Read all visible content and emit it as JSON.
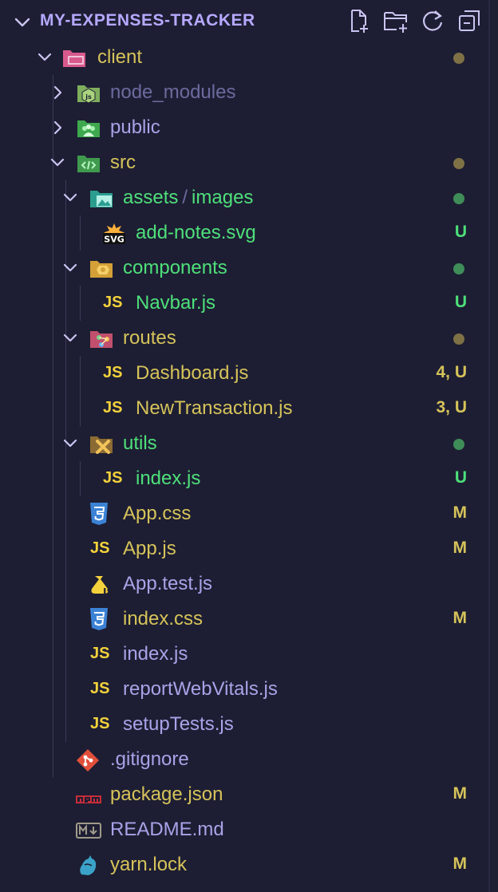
{
  "explorer": {
    "title": "MY-EXPENSES-TRACKER",
    "actions": [
      {
        "name": "new-file-icon"
      },
      {
        "name": "new-folder-icon"
      },
      {
        "name": "refresh-icon"
      },
      {
        "name": "collapse-all-icon"
      }
    ]
  },
  "colors": {
    "modified": "#d6c35a",
    "untracked": "#4ee07a",
    "normal": "#a9a3e8",
    "ignored": "#6c6a9e",
    "dot_modified": "#7e7146",
    "dot_untracked": "#3f8d58"
  },
  "tree": [
    {
      "label": "client",
      "type": "folder",
      "expanded": true,
      "depth": 0,
      "status": "modified-dot",
      "icon": "folder-client-icon"
    },
    {
      "label": "node_modules",
      "type": "folder",
      "expanded": false,
      "depth": 1,
      "status": "ignored",
      "icon": "folder-node-icon"
    },
    {
      "label": "public",
      "type": "folder",
      "expanded": false,
      "depth": 1,
      "status": "normal",
      "icon": "folder-public-icon"
    },
    {
      "label": "src",
      "type": "folder",
      "expanded": true,
      "depth": 1,
      "status": "modified-dot",
      "icon": "folder-src-icon"
    },
    {
      "label": "assets",
      "label2": "images",
      "type": "folder",
      "expanded": true,
      "depth": 2,
      "status": "untracked-dot",
      "icon": "folder-images-icon"
    },
    {
      "label": "add-notes.svg",
      "type": "file",
      "depth": 3,
      "status": "untracked",
      "badge": "U",
      "icon": "svg-file-icon"
    },
    {
      "label": "components",
      "type": "folder",
      "expanded": true,
      "depth": 2,
      "status": "untracked-dot",
      "icon": "folder-components-icon"
    },
    {
      "label": "Navbar.js",
      "type": "file",
      "depth": 3,
      "status": "untracked",
      "badge": "U",
      "icon": "js-file-icon"
    },
    {
      "label": "routes",
      "type": "folder",
      "expanded": true,
      "depth": 2,
      "status": "modified-dot",
      "icon": "folder-routes-icon"
    },
    {
      "label": "Dashboard.js",
      "type": "file",
      "depth": 3,
      "status": "modified",
      "badge": "4, U",
      "icon": "js-file-icon"
    },
    {
      "label": "NewTransaction.js",
      "type": "file",
      "depth": 3,
      "status": "modified",
      "badge": "3, U",
      "icon": "js-file-icon"
    },
    {
      "label": "utils",
      "type": "folder",
      "expanded": true,
      "depth": 2,
      "status": "untracked-dot",
      "icon": "folder-utils-icon"
    },
    {
      "label": "index.js",
      "type": "file",
      "depth": 3,
      "status": "untracked",
      "badge": "U",
      "icon": "js-file-icon"
    },
    {
      "label": "App.css",
      "type": "file",
      "depth": 2,
      "status": "modified",
      "badge": "M",
      "icon": "css-file-icon"
    },
    {
      "label": "App.js",
      "type": "file",
      "depth": 2,
      "status": "modified",
      "badge": "M",
      "icon": "js-file-icon"
    },
    {
      "label": "App.test.js",
      "type": "file",
      "depth": 2,
      "status": "normal",
      "icon": "test-js-file-icon"
    },
    {
      "label": "index.css",
      "type": "file",
      "depth": 2,
      "status": "modified",
      "badge": "M",
      "icon": "css-file-icon"
    },
    {
      "label": "index.js",
      "type": "file",
      "depth": 2,
      "status": "normal",
      "icon": "js-file-icon"
    },
    {
      "label": "reportWebVitals.js",
      "type": "file",
      "depth": 2,
      "status": "normal",
      "icon": "js-file-icon"
    },
    {
      "label": "setupTests.js",
      "type": "file",
      "depth": 2,
      "status": "normal",
      "icon": "js-file-icon"
    },
    {
      "label": ".gitignore",
      "type": "file",
      "depth": 1,
      "status": "normal",
      "icon": "git-file-icon"
    },
    {
      "label": "package.json",
      "type": "file",
      "depth": 1,
      "status": "modified",
      "badge": "M",
      "icon": "npm-file-icon"
    },
    {
      "label": "README.md",
      "type": "file",
      "depth": 1,
      "status": "normal",
      "icon": "markdown-file-icon"
    },
    {
      "label": "yarn.lock",
      "type": "file",
      "depth": 1,
      "status": "modified",
      "badge": "M",
      "icon": "yarn-file-icon"
    }
  ]
}
